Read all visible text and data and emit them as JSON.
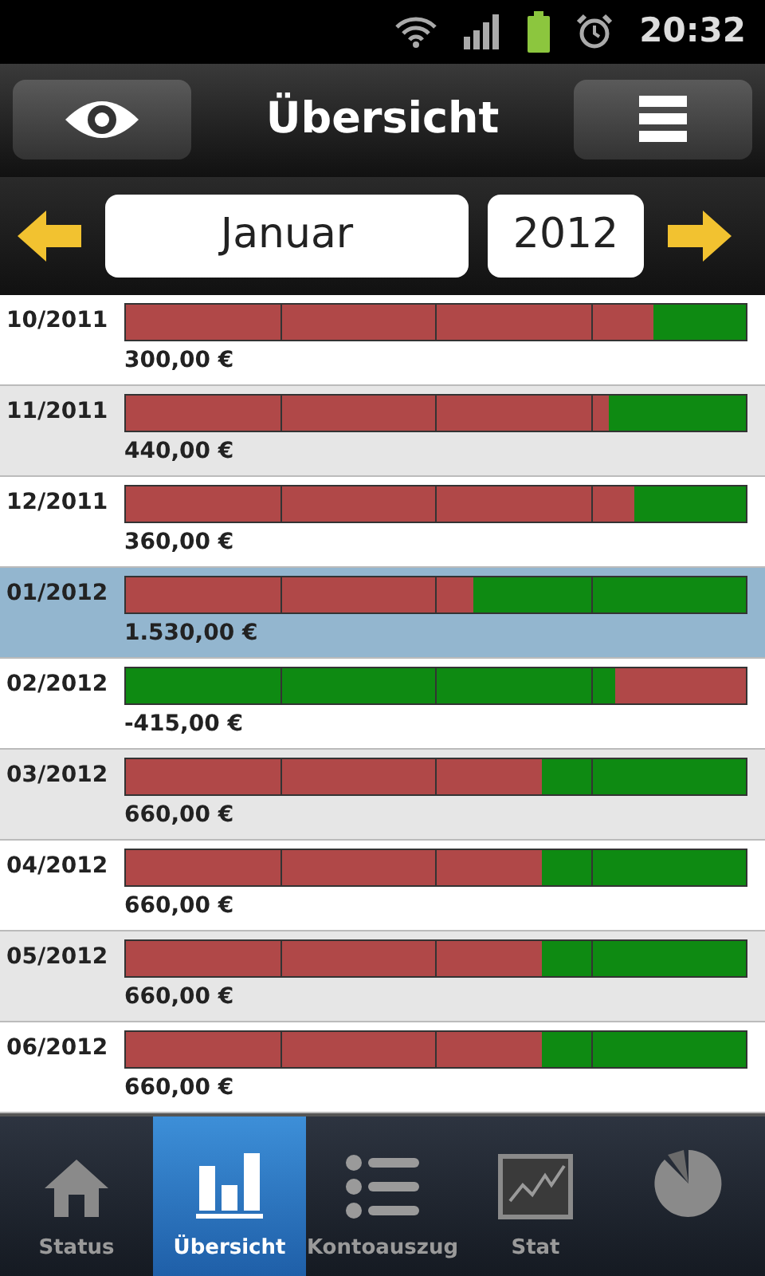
{
  "status_bar": {
    "time": "20:32"
  },
  "header": {
    "title": "Übersicht"
  },
  "period": {
    "month": "Januar",
    "year": "2012"
  },
  "rows": [
    {
      "period": "10/2011",
      "amount": "300,00 €",
      "selected": false,
      "kind": "expense_first",
      "level": 0.85
    },
    {
      "period": "11/2011",
      "amount": "440,00 €",
      "selected": false,
      "kind": "expense_first",
      "level": 0.78
    },
    {
      "period": "12/2011",
      "amount": "360,00 €",
      "selected": false,
      "kind": "expense_first",
      "level": 0.82
    },
    {
      "period": "01/2012",
      "amount": "1.530,00 €",
      "selected": true,
      "kind": "expense_first",
      "level": 0.56
    },
    {
      "period": "02/2012",
      "amount": "-415,00 €",
      "selected": false,
      "kind": "income_first",
      "level": 0.79
    },
    {
      "period": "03/2012",
      "amount": "660,00 €",
      "selected": false,
      "kind": "expense_first",
      "level": 0.67
    },
    {
      "period": "04/2012",
      "amount": "660,00 €",
      "selected": false,
      "kind": "expense_first",
      "level": 0.67
    },
    {
      "period": "05/2012",
      "amount": "660,00 €",
      "selected": false,
      "kind": "expense_first",
      "level": 0.67
    },
    {
      "period": "06/2012",
      "amount": "660,00 €",
      "selected": false,
      "kind": "expense_first",
      "level": 0.67
    }
  ],
  "tabs": [
    {
      "label": "Status",
      "kind": "home",
      "selected": false
    },
    {
      "label": "Übersicht",
      "kind": "bars",
      "selected": true
    },
    {
      "label": "Kontoauszug",
      "kind": "list",
      "selected": false
    },
    {
      "label": "Stat",
      "kind": "chart",
      "selected": false
    },
    {
      "kind": "pie",
      "selected": false
    }
  ]
}
